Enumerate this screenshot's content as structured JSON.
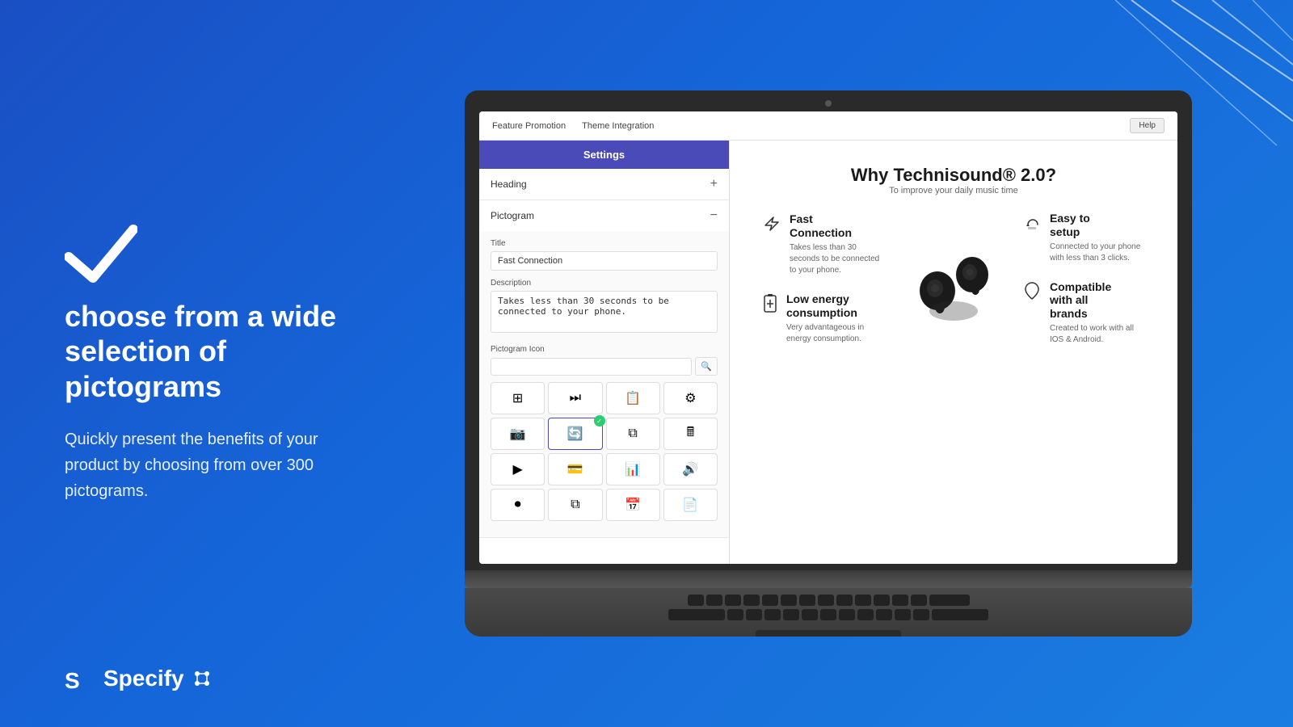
{
  "background": {
    "gradient_start": "#1a4fc4",
    "gradient_end": "#1a7de0"
  },
  "left_panel": {
    "checkmark_label": "checkmark",
    "headline": "choose from a wide selection of pictograms",
    "subtext": "Quickly present the benefits of your product by choosing from over 300 pictograms."
  },
  "logo": {
    "name": "Specify",
    "icon": "specify-logo"
  },
  "app": {
    "nav": {
      "items": [
        "Feature Promotion",
        "Theme Integration"
      ],
      "help_label": "Help"
    },
    "sidebar": {
      "settings_label": "Settings",
      "accordion_items": [
        {
          "label": "Heading",
          "expanded": false,
          "icon": "plus"
        },
        {
          "label": "Pictogram",
          "expanded": true,
          "icon": "minus"
        }
      ],
      "form": {
        "title_label": "Title",
        "title_value": "Fast Connection",
        "description_label": "Description",
        "description_value": "Takes less than 30 seconds to be connected to your phone.",
        "pictogram_icon_label": "Pictogram Icon",
        "search_placeholder": ""
      },
      "icons": [
        {
          "glyph": "⊞",
          "selected": false
        },
        {
          "glyph": "⏭",
          "selected": false
        },
        {
          "glyph": "📋",
          "selected": false
        },
        {
          "glyph": "⚙",
          "selected": false
        },
        {
          "glyph": "🎬",
          "selected": false
        },
        {
          "glyph": "🔄",
          "selected": true
        },
        {
          "glyph": "⧉",
          "selected": false
        },
        {
          "glyph": "🖩",
          "selected": false
        },
        {
          "glyph": "▶",
          "selected": false
        },
        {
          "glyph": "💳",
          "selected": false
        },
        {
          "glyph": "📊",
          "selected": false
        },
        {
          "glyph": "🔊",
          "selected": false
        },
        {
          "glyph": "⏺",
          "selected": false
        },
        {
          "glyph": "⧉",
          "selected": false
        },
        {
          "glyph": "📅",
          "selected": false
        },
        {
          "glyph": "📄",
          "selected": false
        }
      ]
    },
    "preview": {
      "heading": "Why Technisound® 2.0?",
      "subheading": "To improve your daily music time",
      "features": [
        {
          "icon": "⚡",
          "title": "Fast\nConnection",
          "description": "Takes less than 30 seconds to be connected to your phone."
        },
        {
          "icon": "👍",
          "title": "Easy to\nsetup",
          "description": "Connected to your phone with less than 3 clicks."
        },
        {
          "icon": "🔋",
          "title": "Low energy\nconsumption",
          "description": "Very advantageous in energy consumption."
        },
        {
          "icon": "♡",
          "title": "Compatible\nwith all\nbrands",
          "description": "Created to work with all IOS & Android."
        }
      ]
    }
  }
}
